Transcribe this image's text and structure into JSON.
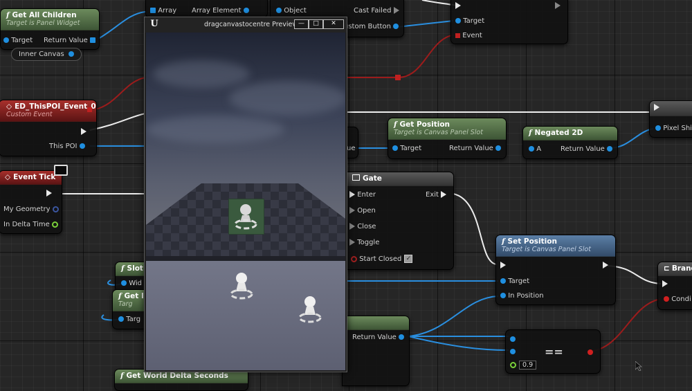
{
  "nodes": {
    "get_all_children": {
      "title": "Get All Children",
      "subtitle": "Target is Panel Widget",
      "target": "Target",
      "return_value": "Return Value"
    },
    "inner_canvas": {
      "label": "Inner Canvas"
    },
    "array_row": {
      "array": "Array",
      "array_element": "Array Element"
    },
    "cast": {
      "object": "Object",
      "cast_failed": "Cast Failed",
      "custom_button": "ustom Button"
    },
    "bind_event": {
      "target": "Target",
      "event": "Event"
    },
    "custom_event": {
      "title": "ED_ThisPOI_Event_0",
      "subtitle": "Custom Event",
      "this_poi": "This POI"
    },
    "event_tick": {
      "title": "Event Tick",
      "my_geometry": "My Geometry",
      "in_delta_time": "In Delta Time"
    },
    "get_position": {
      "title": "Get Position",
      "subtitle": "Target is Canvas Panel Slot",
      "target": "Target",
      "return_value": "Return Value",
      "left_pin": "ue"
    },
    "negated_2d": {
      "title": "Negated 2D",
      "a": "A",
      "return_value": "Return Value"
    },
    "pixel_node": {
      "label": "Pixel Shi"
    },
    "gate": {
      "title": "Gate",
      "enter": "Enter",
      "exit": "Exit",
      "open": "Open",
      "close": "Close",
      "toggle": "Toggle",
      "start_closed": "Start Closed"
    },
    "set_position": {
      "title": "Set Position",
      "subtitle": "Target is Canvas Panel Slot",
      "target": "Target",
      "in_position": "In Position"
    },
    "branch": {
      "title": "Branc",
      "condition": "Condi"
    },
    "slot_node": {
      "title": "Slot",
      "row": "Wid"
    },
    "get_node": {
      "title": "Get I",
      "subtitle": "Targ",
      "row": "Targ"
    },
    "return_value_node": {
      "return_value": "Return Value"
    },
    "equals": {
      "symbol": "==",
      "value": "0.9"
    },
    "world_delta": {
      "title": "Get World Delta Seconds"
    }
  },
  "preview": {
    "title": "dragcanvastocentre Previev",
    "logo": "U",
    "min_glyph": "—",
    "max_glyph": "□",
    "close_glyph": "✕"
  },
  "colors": {
    "wire_exec": "#ececec",
    "wire_object": "#2a8fe0",
    "wire_bool": "#9c1c1c",
    "header_green": "#4e6c44",
    "header_red": "#8a2020",
    "header_blue": "#44668c"
  }
}
